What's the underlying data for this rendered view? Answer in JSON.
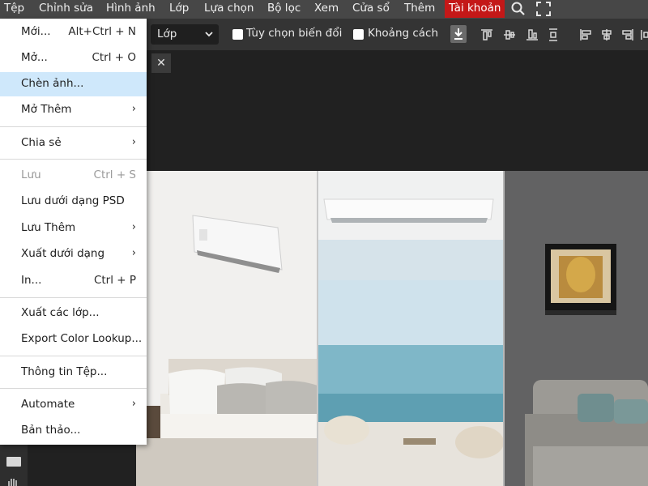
{
  "menubar": {
    "items": [
      "Tệp",
      "Chỉnh sửa",
      "Hình ảnh",
      "Lớp",
      "Lựa chọn",
      "Bộ lọc",
      "Xem",
      "Cửa sổ",
      "Thêm"
    ],
    "account": "Tài khoản",
    "account_color": "#c41818",
    "icons": [
      "search-icon",
      "fullscreen-icon"
    ]
  },
  "optionsbar": {
    "layer_select": "Lớp",
    "transform_label": "Tùy chọn biến đổi",
    "distance_label": "Khoảng cách",
    "transform_checked": false,
    "distance_checked": false,
    "align_icons": [
      "download-icon",
      "align-top-icon",
      "align-vcenter-icon",
      "align-bottom-icon",
      "distribute-v-icon",
      "align-left-icon",
      "align-hcenter-icon",
      "align-right-icon",
      "distribute-h-icon"
    ]
  },
  "tab": {
    "close_symbol": "✕"
  },
  "dropdown": {
    "items": [
      {
        "label": "Mới...",
        "shortcut": "Alt+Ctrl + N"
      },
      {
        "label": "Mở...",
        "shortcut": "Ctrl + O"
      },
      {
        "label": "Chèn ảnh...",
        "highlighted": true
      },
      {
        "label": "Mở Thêm",
        "submenu": true
      },
      {
        "label": "Chia sẻ",
        "submenu": true
      },
      {
        "label": "Lưu",
        "shortcut": "Ctrl + S",
        "disabled": true
      },
      {
        "label": "Lưu dưới dạng PSD"
      },
      {
        "label": "Lưu Thêm",
        "submenu": true
      },
      {
        "label": "Xuất dưới dạng",
        "submenu": true
      },
      {
        "label": "In...",
        "shortcut": "Ctrl + P"
      },
      {
        "label": "Xuất các lớp..."
      },
      {
        "label": "Export Color Lookup..."
      },
      {
        "label": "Thông tin Tệp..."
      },
      {
        "label": "Automate",
        "submenu": true
      },
      {
        "label": "Bản thảo..."
      }
    ],
    "submenu_symbol": "›",
    "highlight_color": "#cfe8fb"
  }
}
